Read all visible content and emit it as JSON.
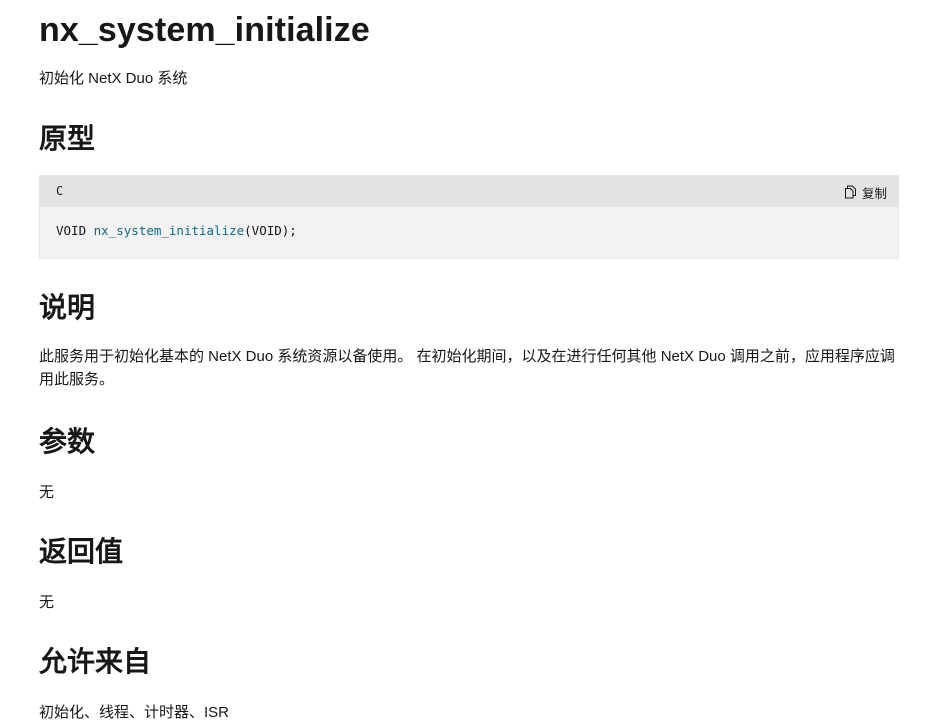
{
  "title": "nx_system_initialize",
  "summary": "初始化 NetX Duo 系统",
  "sections": {
    "prototype": {
      "heading": "原型",
      "code": {
        "language": "C",
        "copy_label": "复制",
        "return_type": "VOID",
        "function_name": "nx_system_initialize",
        "args": "(VOID);"
      }
    },
    "description": {
      "heading": "说明",
      "text": "此服务用于初始化基本的 NetX Duo 系统资源以备使用。 在初始化期间，以及在进行任何其他 NetX Duo 调用之前，应用程序应调用此服务。"
    },
    "parameters": {
      "heading": "参数",
      "text": "无"
    },
    "return_values": {
      "heading": "返回值",
      "text": "无"
    },
    "allowed_from": {
      "heading": "允许来自",
      "text": "初始化、线程、计时器、ISR"
    }
  },
  "colors": {
    "function_name": "#0e6a8a",
    "code_header_bg": "#e3e3e3",
    "code_body_bg": "#f2f2f2",
    "text": "#171717"
  },
  "icons": {
    "copy": "copy-icon"
  }
}
